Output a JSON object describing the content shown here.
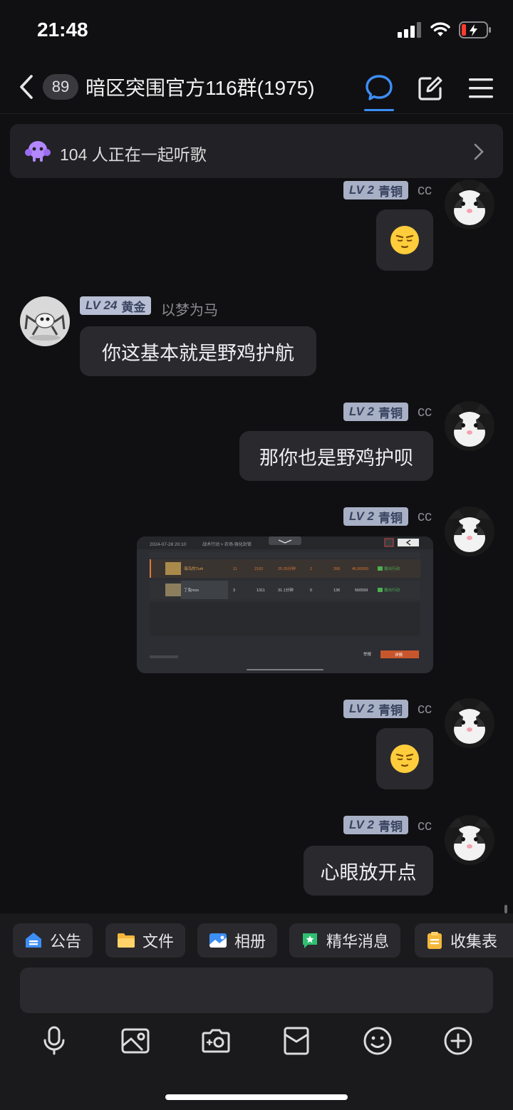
{
  "status": {
    "time": "21:48"
  },
  "header": {
    "unread": "89",
    "title": "暗区突围官方116群(1975)"
  },
  "banner": {
    "text": "104 人正在一起听歌"
  },
  "messages": [
    {
      "side": "right",
      "level": "LV 2",
      "rank": "青铜",
      "nick": "cc",
      "type": "emoji"
    },
    {
      "side": "left",
      "level": "LV 24",
      "rank": "黄金",
      "nick": "以梦为马",
      "type": "text",
      "text": "你这基本就是野鸡护航"
    },
    {
      "side": "right",
      "level": "LV 2",
      "rank": "青铜",
      "nick": "cc",
      "type": "text",
      "text": "那你也是野鸡护呗"
    },
    {
      "side": "right",
      "level": "LV 2",
      "rank": "青铜",
      "nick": "cc",
      "type": "image"
    },
    {
      "side": "right",
      "level": "LV 2",
      "rank": "青铜",
      "nick": "cc",
      "type": "emoji"
    },
    {
      "side": "right",
      "level": "LV 2",
      "rank": "青铜",
      "nick": "cc",
      "type": "text",
      "text": "心眼放开点"
    }
  ],
  "screenshot": {
    "timestamp": "2024-07-28 20:10",
    "breadcrumb": "战术行动 > 农场-强化封锁",
    "row1_name": "海鸟的Turk",
    "row1_values": [
      "11",
      "2162",
      "25.35分钟",
      "2",
      "268",
      "46,80000"
    ],
    "row1_status": "撤出行动",
    "row2_name": "丁兔mzs",
    "row2_values": [
      "3",
      "1311",
      "31.1分钟",
      "0",
      "136",
      "560569"
    ],
    "row2_status": "撤出行动",
    "report": "举报",
    "detail": "详情"
  },
  "quick_actions": [
    {
      "label": "公告",
      "icon": "announcement-icon"
    },
    {
      "label": "文件",
      "icon": "folder-icon"
    },
    {
      "label": "相册",
      "icon": "album-icon"
    },
    {
      "label": "精华消息",
      "icon": "featured-icon"
    },
    {
      "label": "收集表",
      "icon": "clipboard-icon"
    }
  ],
  "input": {
    "placeholder": ""
  },
  "colors": {
    "accent": "#3d8ef5",
    "bg": "#101012",
    "bubble": "#2a2a2e",
    "badge": "#a8b0c6"
  }
}
